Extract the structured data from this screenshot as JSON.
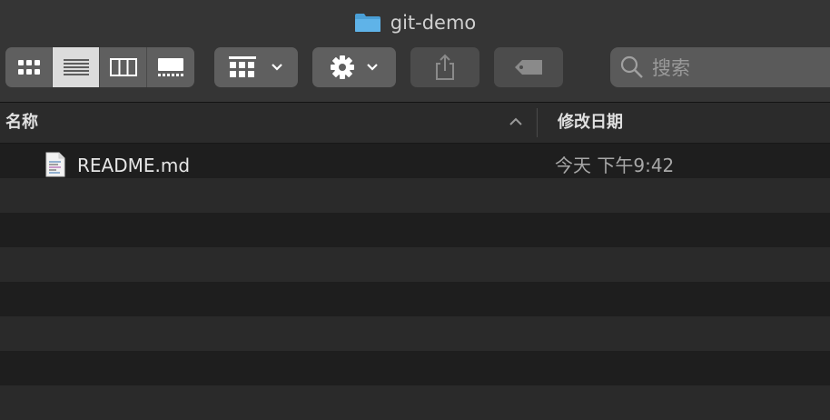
{
  "window": {
    "title": "git-demo",
    "folder_icon": "folder-icon"
  },
  "toolbar": {
    "view_modes": [
      {
        "name": "icon-view",
        "icon": "grid-icon",
        "active": false
      },
      {
        "name": "list-view",
        "icon": "list-icon",
        "active": true
      },
      {
        "name": "column-view",
        "icon": "columns-icon",
        "active": false
      },
      {
        "name": "gallery-view",
        "icon": "gallery-icon",
        "active": false
      }
    ],
    "group_button_icon": "group-grid-icon",
    "action_button_icon": "gear-icon",
    "share_button_icon": "share-icon",
    "tag_button_icon": "tag-icon",
    "search_placeholder": "搜索"
  },
  "columns": {
    "name": "名称",
    "date_modified": "修改日期",
    "sort_direction": "ascending"
  },
  "files": [
    {
      "name": "README.md",
      "modified": "今天 下午9:42",
      "icon": "text-document-icon"
    }
  ],
  "colors": {
    "folder_blue": "#5fb3e8",
    "background": "#1e1e1e",
    "toolbar": "#353535"
  }
}
